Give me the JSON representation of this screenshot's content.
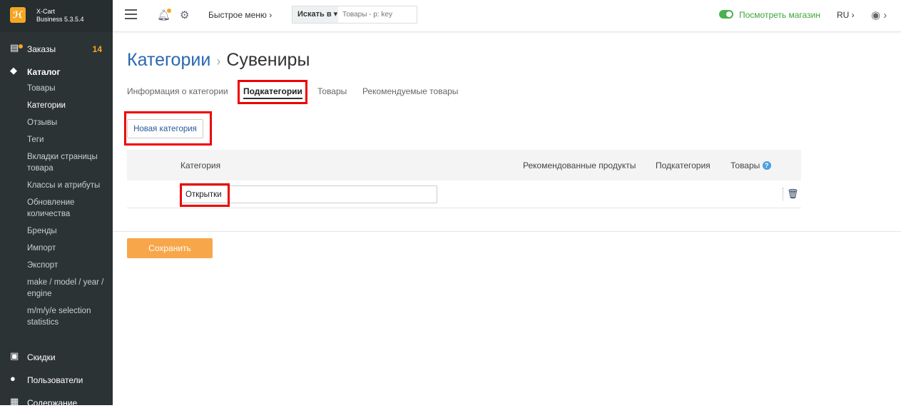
{
  "app": {
    "logo_glyph": "ℋ",
    "name_line1": "X-Cart",
    "name_line2": "Business 5.3.5.4"
  },
  "sidebar": {
    "orders": {
      "label": "Заказы",
      "count": "14",
      "icon": "orders-icon"
    },
    "catalog": {
      "label": "Каталог",
      "icon": "tag-icon"
    },
    "catalog_items": [
      "Товары",
      "Категории",
      "Отзывы",
      "Теги",
      "Вкладки страницы товара",
      "Классы и атрибуты",
      "Обновление количества",
      "Бренды",
      "Импорт",
      "Экспорт",
      "make / model / year / engine",
      "m/m/y/e selection statistics"
    ],
    "discounts": {
      "label": "Скидки",
      "icon": "gift-icon"
    },
    "users": {
      "label": "Пользователи",
      "icon": "users-icon"
    },
    "content": {
      "label": "Содержание",
      "icon": "content-icon"
    }
  },
  "topbar": {
    "quick_menu": "Быстрое меню ›",
    "search_in": "Искать в ▾",
    "search_placeholder": "Товары - р: key",
    "view_store": "Посмотреть магазин",
    "lang": "RU ›"
  },
  "page": {
    "breadcrumb": "Категории",
    "separator": "›",
    "title": "Сувениры",
    "tabs": [
      "Информация о категории",
      "Подкатегории",
      "Товары",
      "Рекомендуемые товары"
    ],
    "active_tab": "Подкатегории",
    "new_category": "Новая категория",
    "table": {
      "headers": {
        "category": "Категория",
        "featured": "Рекомендованные продукты",
        "subcategory": "Подкатегория",
        "products": "Товары"
      },
      "rows": [
        {
          "name": "Открытки"
        }
      ]
    },
    "save": "Сохранить"
  },
  "colors": {
    "accent": "#2a67b1",
    "orange": "#f5a623",
    "highlight": "#e00000",
    "save_button": "#f7a74a",
    "sidebar_bg": "#2b3335"
  }
}
